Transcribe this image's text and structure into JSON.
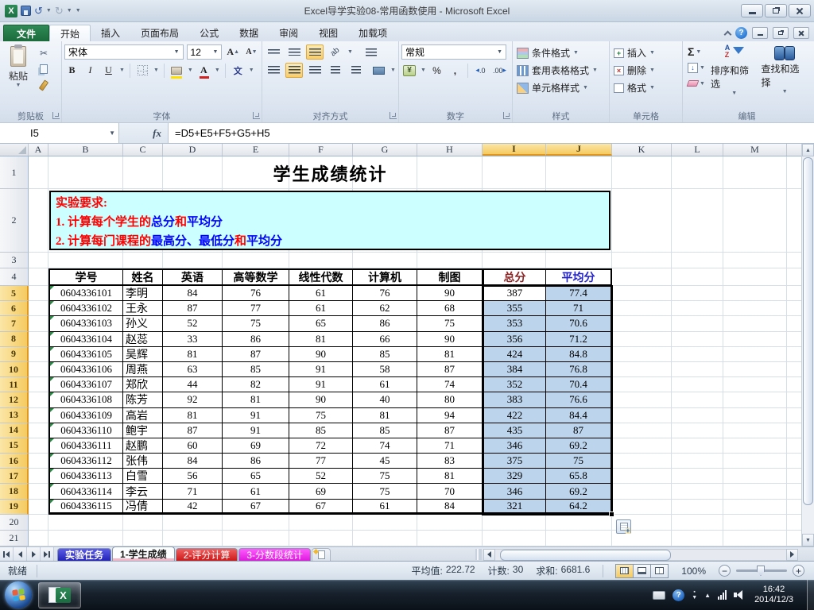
{
  "window": {
    "title": "Excel导学实验08-常用函数使用 - Microsoft Excel"
  },
  "ribbon": {
    "file_tab": "文件",
    "tabs": [
      {
        "label": "开始",
        "active": true
      },
      {
        "label": "插入",
        "active": false
      },
      {
        "label": "页面布局",
        "active": false
      },
      {
        "label": "公式",
        "active": false
      },
      {
        "label": "数据",
        "active": false
      },
      {
        "label": "审阅",
        "active": false
      },
      {
        "label": "视图",
        "active": false
      },
      {
        "label": "加载项",
        "active": false
      }
    ],
    "clipboard": {
      "label": "剪贴板",
      "paste": "粘贴"
    },
    "font": {
      "label": "字体",
      "name": "宋体",
      "size": "12",
      "bold": "B",
      "italic": "I",
      "underline": "U",
      "grow": "A",
      "shrink": "A",
      "phonetic": "文"
    },
    "alignment": {
      "label": "对齐方式"
    },
    "number": {
      "label": "数字",
      "format": "常规",
      "currency": "¥",
      "percent": "%",
      "comma": ",",
      "dec_inc": ".0",
      "dec_dec": ".00"
    },
    "styles": {
      "label": "样式",
      "conditional": "条件格式",
      "table_format": "套用表格格式",
      "cell_styles": "单元格样式"
    },
    "cells": {
      "label": "单元格",
      "insert": "插入",
      "delete": "删除",
      "format": "格式"
    },
    "editing": {
      "label": "编辑",
      "autosum": "Σ",
      "sort": "排序和筛选",
      "find": "查找和选择"
    }
  },
  "formula_bar": {
    "name_box": "I5",
    "fx_label": "fx",
    "formula": "=D5+E5+F5+G5+H5"
  },
  "grid": {
    "columns": [
      "A",
      "B",
      "C",
      "D",
      "E",
      "F",
      "G",
      "H",
      "I",
      "J",
      "K",
      "L",
      "M"
    ],
    "selected_columns": [
      "I",
      "J"
    ],
    "row_count": 21,
    "selected_row_start": 5,
    "selected_row_end": 19,
    "sheet_title": "学生成绩统计",
    "requirements": [
      [
        {
          "text": "实验要求:",
          "color": "red"
        }
      ],
      [
        {
          "text": "1. 计算每个学生的",
          "color": "red"
        },
        {
          "text": "总分",
          "color": "blue"
        },
        {
          "text": "和",
          "color": "red"
        },
        {
          "text": "平均分",
          "color": "blue"
        }
      ],
      [
        {
          "text": "2. 计算每门课程的",
          "color": "red"
        },
        {
          "text": "最高分、最低分",
          "color": "blue"
        },
        {
          "text": "和",
          "color": "red"
        },
        {
          "text": "平均分",
          "color": "blue"
        }
      ]
    ],
    "table": {
      "headers": [
        {
          "text": "学号",
          "color": "#000000"
        },
        {
          "text": "姓名",
          "color": "#000000"
        },
        {
          "text": "英语",
          "color": "#000000"
        },
        {
          "text": "高等数学",
          "color": "#000000"
        },
        {
          "text": "线性代数",
          "color": "#000000"
        },
        {
          "text": "计算机",
          "color": "#000000"
        },
        {
          "text": "制图",
          "color": "#000000"
        },
        {
          "text": "总分",
          "color": "#8B2323"
        },
        {
          "text": "平均分",
          "color": "#2222CC"
        }
      ],
      "rows": [
        [
          "0604336101",
          "李明",
          "84",
          "76",
          "61",
          "76",
          "90",
          "387",
          "77.4"
        ],
        [
          "0604336102",
          "王永",
          "87",
          "77",
          "61",
          "62",
          "68",
          "355",
          "71"
        ],
        [
          "0604336103",
          "孙义",
          "52",
          "75",
          "65",
          "86",
          "75",
          "353",
          "70.6"
        ],
        [
          "0604336104",
          "赵蕊",
          "33",
          "86",
          "81",
          "66",
          "90",
          "356",
          "71.2"
        ],
        [
          "0604336105",
          "吴辉",
          "81",
          "87",
          "90",
          "85",
          "81",
          "424",
          "84.8"
        ],
        [
          "0604336106",
          "周燕",
          "63",
          "85",
          "91",
          "58",
          "87",
          "384",
          "76.8"
        ],
        [
          "0604336107",
          "郑欣",
          "44",
          "82",
          "91",
          "61",
          "74",
          "352",
          "70.4"
        ],
        [
          "0604336108",
          "陈芳",
          "92",
          "81",
          "90",
          "40",
          "80",
          "383",
          "76.6"
        ],
        [
          "0604336109",
          "高岩",
          "81",
          "91",
          "75",
          "81",
          "94",
          "422",
          "84.4"
        ],
        [
          "0604336110",
          "鲍宇",
          "87",
          "91",
          "85",
          "85",
          "87",
          "435",
          "87"
        ],
        [
          "0604336111",
          "赵鹏",
          "60",
          "69",
          "72",
          "74",
          "71",
          "346",
          "69.2"
        ],
        [
          "0604336112",
          "张伟",
          "84",
          "86",
          "77",
          "45",
          "83",
          "375",
          "75"
        ],
        [
          "0604336113",
          "白雪",
          "56",
          "65",
          "52",
          "75",
          "81",
          "329",
          "65.8"
        ],
        [
          "0604336114",
          "李云",
          "71",
          "61",
          "69",
          "75",
          "70",
          "346",
          "69.2"
        ],
        [
          "0604336115",
          "冯倩",
          "42",
          "67",
          "67",
          "61",
          "84",
          "321",
          "64.2"
        ]
      ],
      "active_cell": "I5"
    }
  },
  "sheet_bar": {
    "tabs": [
      {
        "label": "实验任务",
        "color": "blue"
      },
      {
        "label": "1-学生成绩",
        "color": "active"
      },
      {
        "label": "2-评分计算",
        "color": "red"
      },
      {
        "label": "3-分数段统计",
        "color": "magenta"
      }
    ]
  },
  "status_bar": {
    "ready": "就绪",
    "average_label": "平均值:",
    "average_value": "222.72",
    "count_label": "计数:",
    "count_value": "30",
    "sum_label": "求和:",
    "sum_value": "6681.6",
    "zoom_level": "100%"
  },
  "taskbar": {
    "time": "16:42",
    "date": "2014/12/3"
  }
}
